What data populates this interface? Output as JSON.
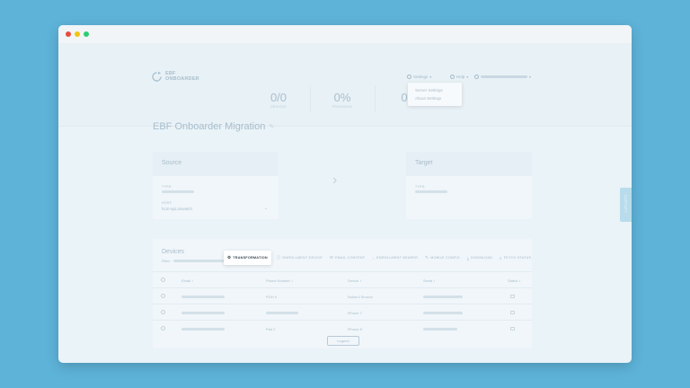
{
  "colors": {
    "desktop": "#5eb3d9",
    "window": "#eaf3f8",
    "accent": "#3b4a55"
  },
  "logo": {
    "line1": "EBF",
    "line2": "ONBOARDER",
    "icon": "refresh-logo-icon"
  },
  "nav": {
    "settings": "Settings",
    "help": "Help",
    "settings_menu": [
      "Server Settings",
      "About Settings"
    ]
  },
  "stats": [
    {
      "value": "0/0",
      "label": "DEVICES"
    },
    {
      "value": "0%",
      "label": "PROGRESS"
    },
    {
      "value": "0",
      "label": ""
    }
  ],
  "page_title": "EBF Onboarder Migration",
  "source": {
    "title": "Source",
    "type_label": "TYPE:",
    "host_label": "HOST:",
    "host_value": "hcm-api.airwatch"
  },
  "target": {
    "title": "Target",
    "type_label": "TYPE:"
  },
  "devices": {
    "title": "Devices",
    "filter_label": "Filter:",
    "actions": [
      {
        "label": "TRANSFORMATION",
        "icon": "gear-icon",
        "primary": true
      },
      {
        "label": "ENROLLMENT DEVICE",
        "icon": "info-icon",
        "primary": false
      },
      {
        "label": "EMAIL CONTENT",
        "icon": "mail-icon",
        "primary": false
      },
      {
        "label": "ENROLLMENT BEARER",
        "icon": "lightbulb-icon",
        "primary": false
      },
      {
        "label": "MOBILE CONFIG",
        "icon": "wrench-icon",
        "primary": false
      },
      {
        "label": "DOWNLOAD",
        "icon": "download-icon",
        "primary": false
      },
      {
        "label": "FETCH STATUS",
        "icon": "search-icon",
        "primary": false
      }
    ],
    "columns": [
      "Email ↑",
      "Phone Number ↕",
      "Device ↕",
      "Serial ↕",
      "Status ↕"
    ],
    "rows": [
      {
        "phone": "POH 4",
        "device": "Nokia 6 Sirocco"
      },
      {
        "phone": "",
        "device": "iPhone 7"
      },
      {
        "phone": "Pad 2",
        "device": "iPhone 8"
      }
    ],
    "legend": "Legend"
  },
  "side_tab": "SUPPORT"
}
